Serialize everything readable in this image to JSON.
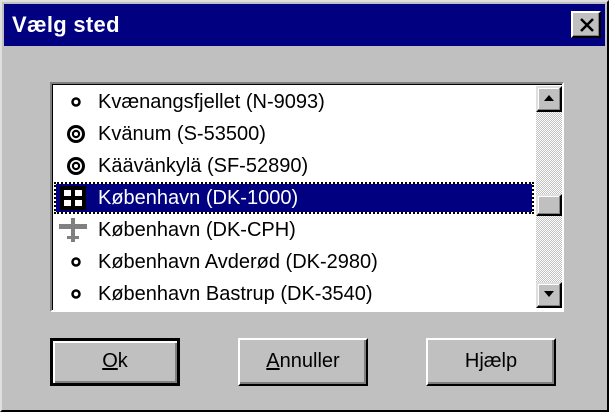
{
  "window": {
    "title": "Vælg sted",
    "close_glyph": "✕"
  },
  "list": {
    "items": [
      {
        "label": "Kvænangsfjellet (N-9093)",
        "icon": "small-dot-icon",
        "selected": false
      },
      {
        "label": "Kvänum (S-53500)",
        "icon": "target-icon",
        "selected": false
      },
      {
        "label": "Käävänkylä (SF-52890)",
        "icon": "target-icon",
        "selected": false
      },
      {
        "label": "København (DK-1000)",
        "icon": "city-grid-icon",
        "selected": true
      },
      {
        "label": "København (DK-CPH)",
        "icon": "airport-plane-icon",
        "selected": false
      },
      {
        "label": "København Avderød (DK-2980)",
        "icon": "small-dot-icon",
        "selected": false
      },
      {
        "label": "København Bastrup (DK-3540)",
        "icon": "small-dot-icon",
        "selected": false
      }
    ]
  },
  "buttons": {
    "ok": {
      "mnemonic": "O",
      "rest": "k"
    },
    "cancel": {
      "mnemonic": "A",
      "rest": "nnuller"
    },
    "help": {
      "pre": "H",
      "mnemonic": "j",
      "rest": "ælp"
    }
  },
  "colors": {
    "titlebar": "#000080",
    "face": "#c0c0c0",
    "selection": "#000080"
  }
}
